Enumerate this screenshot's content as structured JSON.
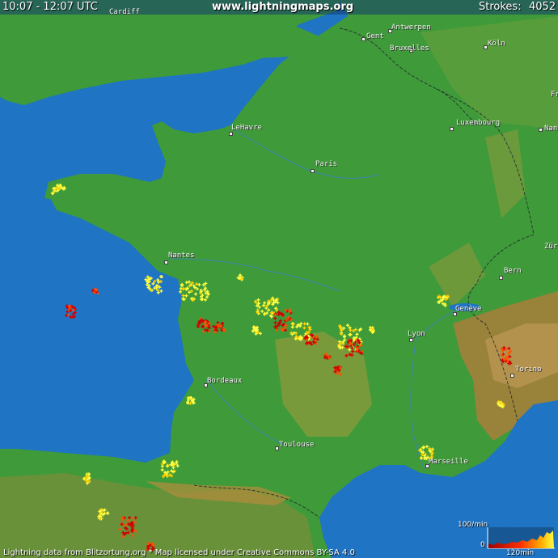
{
  "header": {
    "time_range": "10:07 - 12:07 UTC",
    "site": "www.lightningmaps.org",
    "strokes_label": "Strokes:",
    "strokes_count": "4052"
  },
  "footer": {
    "credit": "Lightning data from Blitzortung.org  *  Map licensed under Creative Commons BY-SA 4.0"
  },
  "legend": {
    "top_label": "100/min",
    "zero_label": "0",
    "time_label": "120min"
  },
  "cities": [
    "Cardiff",
    "Gent",
    "Antwerpen",
    "Bruxelles",
    "Köln",
    "Luxembourg",
    "LeHavre",
    "Paris",
    "Nantes",
    "Bern",
    "Genève",
    "Lyon",
    "Bordeaux",
    "Torino",
    "Toulouse",
    "Marseille",
    "Fr",
    "Nanc",
    "Zür"
  ],
  "colors": {
    "sea": "#1f74c4",
    "land": "#3f9a3a",
    "highland": "#9a8b3a",
    "recent_strike": "#ffff40",
    "old_strike": "#d00000"
  }
}
